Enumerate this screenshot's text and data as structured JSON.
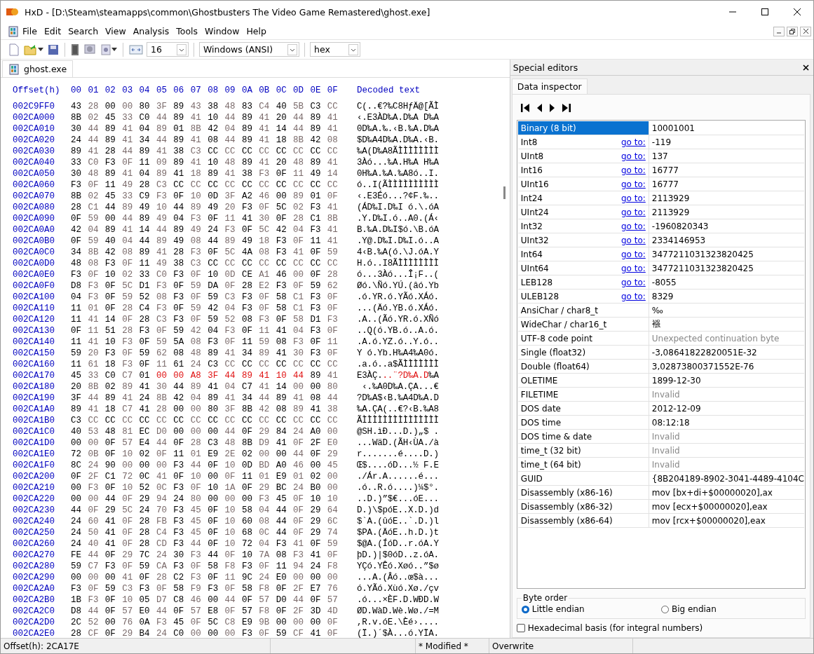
{
  "window": {
    "title": "HxD - [D:\\Steam\\steamapps\\common\\Ghostbusters The Video Game Remastered\\ghost.exe]"
  },
  "menu": [
    "File",
    "Edit",
    "Search",
    "View",
    "Analysis",
    "Tools",
    "Window",
    "Help"
  ],
  "toolbar": {
    "bytes_per_row": "16",
    "charset": "Windows (ANSI)",
    "offset_base": "hex"
  },
  "tabs": [
    {
      "label": "ghost.exe",
      "selected": true
    }
  ],
  "hex": {
    "offset_header": "Offset(h)",
    "columns": [
      "00",
      "01",
      "02",
      "03",
      "04",
      "05",
      "06",
      "07",
      "08",
      "09",
      "0A",
      "0B",
      "0C",
      "0D",
      "0E",
      "0F"
    ],
    "text_header": "Decoded text",
    "rows": [
      {
        "offset": "002C9FF0",
        "segments": [
          {
            "bytes": "43 28 00 00 80 3F 89 43 38 48 83 C4 40 5B C3 CC",
            "text": "C(..€?‰C8HƒÄ@[ÃÌ",
            "selected": false
          }
        ]
      },
      {
        "offset": "002CA000",
        "segments": [
          {
            "bytes": "8B 02 45 33 C0 44 89 41 10 44 89 41 20 44 89 41",
            "text": "‹.E3ÀD‰A.D‰A D‰A",
            "selected": false
          }
        ]
      },
      {
        "offset": "002CA010",
        "segments": [
          {
            "bytes": "30 44 89 41 04 89 01 8B 42 04 89 41 14 44 89 41",
            "text": "0D‰A.‰.‹B.‰A.D‰A",
            "selected": false
          }
        ]
      },
      {
        "offset": "002CA020",
        "segments": [
          {
            "bytes": "24 44 89 41 34 44 89 41 08 44 89 41 18 8B 42 08",
            "text": "$D‰A4D‰A.D‰A.‹B.",
            "selected": false
          }
        ]
      },
      {
        "offset": "002CA030",
        "segments": [
          {
            "bytes": "89 41 28 44 89 41 38 C3 CC CC CC CC CC CC CC CC",
            "text": "‰A(D‰A8ÃÌÌÌÌÌÌÌÌ",
            "selected": false
          }
        ]
      },
      {
        "offset": "002CA040",
        "segments": [
          {
            "bytes": "33 C0 F3 0F 11 09 89 41 10 48 89 41 20 48 89 41",
            "text": "3Àó...‰A.H‰A H‰A",
            "selected": false
          }
        ]
      },
      {
        "offset": "002CA050",
        "segments": [
          {
            "bytes": "30 48 89 41 04 89 41 18 89 41 38 F3 0F 11 49 14",
            "text": "0H‰A.‰A.‰A8ó..I.",
            "selected": false
          }
        ]
      },
      {
        "offset": "002CA060",
        "segments": [
          {
            "bytes": "F3 0F 11 49 28 C3 CC CC CC CC CC CC CC CC CC CC",
            "text": "ó..I(ÃÌÌÌÌÌÌÌÌÌÌ",
            "selected": false
          }
        ]
      },
      {
        "offset": "002CA070",
        "segments": [
          {
            "bytes": "8B 02 45 33 C9 F3 0F 10 0D 3F A2 46 00 89 01 0F",
            "text": "‹.E3Éó...?¢F.‰..",
            "selected": false
          }
        ]
      },
      {
        "offset": "002CA080",
        "segments": [
          {
            "bytes": "28 C1 44 89 49 10 44 89 49 20 F3 0F 5C 02 F3 41",
            "text": "(ÁD‰I.D‰I ó.\\.óA",
            "selected": false
          }
        ]
      },
      {
        "offset": "002CA090",
        "segments": [
          {
            "bytes": "0F 59 00 44 89 49 04 F3 0F 11 41 30 0F 28 C1 8B",
            "text": ".Y.D‰I.ó..A0.(Á‹",
            "selected": false
          }
        ]
      },
      {
        "offset": "002CA0A0",
        "segments": [
          {
            "bytes": "42 04 89 41 14 44 89 49 24 F3 0F 5C 42 04 F3 41",
            "text": "B.‰A.D‰I$ó.\\B.óA",
            "selected": false
          }
        ]
      },
      {
        "offset": "002CA0B0",
        "segments": [
          {
            "bytes": "0F 59 40 04 44 89 49 08 44 89 49 18 F3 0F 11 41",
            "text": ".Y@.D‰I.D‰I.ó..A",
            "selected": false
          }
        ]
      },
      {
        "offset": "002CA0C0",
        "segments": [
          {
            "bytes": "34 8B 42 08 89 41 28 F3 0F 5C 4A 08 F3 41 0F 59",
            "text": "4‹B.‰A(ó.\\J.óA.Y",
            "selected": false
          }
        ]
      },
      {
        "offset": "002CA0D0",
        "segments": [
          {
            "bytes": "48 08 F3 0F 11 49 38 C3 CC CC CC CC CC CC CC CC",
            "text": "H.ó..I8ÃÌÌÌÌÌÌÌÌ",
            "selected": false
          }
        ]
      },
      {
        "offset": "002CA0E0",
        "segments": [
          {
            "bytes": "F3 0F 10 02 33 C0 F3 0F 10 0D CE A1 46 00 0F 28",
            "text": "ó...3Àó...Î¡F..(",
            "selected": false
          }
        ]
      },
      {
        "offset": "002CA0F0",
        "segments": [
          {
            "bytes": "D8 F3 0F 5C D1 F3 0F 59 DA 0F 28 E2 F3 0F 59 62",
            "text": "Øó.\\Ñó.YÚ.(âó.Yb",
            "selected": false
          }
        ]
      },
      {
        "offset": "002CA100",
        "segments": [
          {
            "bytes": "04 F3 0F 59 52 08 F3 0F 59 C3 F3 0F 58 C1 F3 0F",
            "text": ".ó.YR.ó.YÃó.XÁó.",
            "selected": false
          }
        ]
      },
      {
        "offset": "002CA110",
        "segments": [
          {
            "bytes": "11 01 0F 28 C4 F3 0F 59 42 04 F3 0F 58 C1 F3 0F",
            "text": "...(Äó.YB.ó.XÁó.",
            "selected": false
          }
        ]
      },
      {
        "offset": "002CA120",
        "segments": [
          {
            "bytes": "11 41 14 0F 28 C3 F3 0F 59 52 08 F3 0F 58 D1 F3",
            "text": ".A..(Ãó.YR.ó.XÑó",
            "selected": false
          }
        ]
      },
      {
        "offset": "002CA130",
        "segments": [
          {
            "bytes": "0F 11 51 28 F3 0F 59 42 04 F3 0F 11 41 04 F3 0F",
            "text": "..Q(ó.YB.ó..A.ó.",
            "selected": false
          }
        ]
      },
      {
        "offset": "002CA140",
        "segments": [
          {
            "bytes": "11 41 10 F3 0F 59 5A 08 F3 0F 11 59 08 F3 0F 11",
            "text": ".A.ó.YZ.ó..Y.ó..",
            "selected": false
          }
        ]
      },
      {
        "offset": "002CA150",
        "segments": [
          {
            "bytes": "59 20 F3 0F 59 62 08 48 89 41 34 89 41 30 F3 0F",
            "text": "Y ó.Yb.H‰A4‰A0ó.",
            "selected": false
          }
        ]
      },
      {
        "offset": "002CA160",
        "segments": [
          {
            "bytes": "11 61 18 F3 0F 11 61 24 C3 CC CC CC CC CC CC CC",
            "text": ".a.ó..a$ÃÌÌÌÌÌÌÌ",
            "selected": false
          }
        ]
      },
      {
        "offset": "002CA170",
        "segments": [
          {
            "bytes": "45 33 C0 C7 01",
            "text": "E3ÀÇ.",
            "selected": false
          },
          {
            "bytes": "00 00 A8 3F 44 89 41 10 44",
            "text": "..¨?D‰A.D",
            "selected": true
          },
          {
            "bytes": "89 41",
            "text": "‰A",
            "selected": false
          }
        ]
      },
      {
        "offset": "002CA180",
        "segments": [
          {
            "bytes": "20 8B 02 89 41 30 44 89 41 04 C7 41 14 00 00 80",
            "text": " ‹.‰A0D‰A.ÇA...€",
            "selected": false
          }
        ]
      },
      {
        "offset": "002CA190",
        "segments": [
          {
            "bytes": "3F 44 89 41 24 8B 42 04 89 41 34 44 89 41 08 44",
            "text": "?D‰A$‹B.‰A4D‰A.D",
            "selected": false
          }
        ]
      },
      {
        "offset": "002CA1A0",
        "segments": [
          {
            "bytes": "89 41 18 C7 41 28 00 00 80 3F 8B 42 08 89 41 38",
            "text": "‰A.ÇA(..€?‹B.‰A8",
            "selected": false
          }
        ]
      },
      {
        "offset": "002CA1B0",
        "segments": [
          {
            "bytes": "C3 CC CC CC CC CC CC CC CC CC CC CC CC CC CC CC",
            "text": "ÃÌÌÌÌÌÌÌÌÌÌÌÌÌÌÌ",
            "selected": false
          }
        ]
      },
      {
        "offset": "002CA1C0",
        "segments": [
          {
            "bytes": "40 53 48 81 EC D0 00 00 00 44 0F 29 84 24 A0 00",
            "text": "@SH.ìÐ...D.)„$ .",
            "selected": false
          }
        ]
      },
      {
        "offset": "002CA1D0",
        "segments": [
          {
            "bytes": "00 00 0F 57 E4 44 0F 28 C3 48 8B D9 41 0F 2F E0",
            "text": "...WäD.(ÃH‹ÙA./à",
            "selected": false
          }
        ]
      },
      {
        "offset": "002CA1E0",
        "segments": [
          {
            "bytes": "72 0B 0F 10 02 0F 11 01 E9 2E 02 00 00 44 0F 29",
            "text": "r.......é....D.)",
            "selected": false
          }
        ]
      },
      {
        "offset": "002CA1F0",
        "segments": [
          {
            "bytes": "8C 24 90 00 00 00 F3 44 0F 10 0D BD A0 46 00 45",
            "text": "Œ$....óD...½ F.E",
            "selected": false
          }
        ]
      },
      {
        "offset": "002CA200",
        "segments": [
          {
            "bytes": "0F 2F C1 72 0C 41 0F 10 00 0F 11 01 E9 01 02 00",
            "text": "./Ár.A......é...",
            "selected": false
          }
        ]
      },
      {
        "offset": "002CA210",
        "segments": [
          {
            "bytes": "00 F3 0F 10 52 0C F3 0F 10 1A 0F 29 BC 24 B0 00",
            "text": ".ó..R.ó....)¼$°.",
            "selected": false
          }
        ]
      },
      {
        "offset": "002CA220",
        "segments": [
          {
            "bytes": "00 00 44 0F 29 94 24 80 00 00 00 F3 45 0F 10 10",
            "text": "..D.)”$€...óE...",
            "selected": false
          }
        ]
      },
      {
        "offset": "002CA230",
        "segments": [
          {
            "bytes": "44 0F 29 5C 24 70 F3 45 0F 10 58 04 44 0F 29 64",
            "text": "D.)\\$póE..X.D.)d",
            "selected": false
          }
        ]
      },
      {
        "offset": "002CA240",
        "segments": [
          {
            "bytes": "24 60 41 0F 28 FB F3 45 0F 10 60 08 44 0F 29 6C",
            "text": "$`A.(ûóE..`.D.)l",
            "selected": false
          }
        ]
      },
      {
        "offset": "002CA250",
        "segments": [
          {
            "bytes": "24 50 41 0F 28 C4 F3 45 0F 10 68 0C 44 0F 29 74",
            "text": "$PA.(ÄóE..h.D.)t",
            "selected": false
          }
        ]
      },
      {
        "offset": "002CA260",
        "segments": [
          {
            "bytes": "24 40 41 0F 28 CD F3 44 0F 10 72 04 F3 41 0F 59",
            "text": "$@A.(ÍóD..r.óA.Y",
            "selected": false
          }
        ]
      },
      {
        "offset": "002CA270",
        "segments": [
          {
            "bytes": "FE 44 0F 29 7C 24 30 F3 44 0F 10 7A 08 F3 41 0F",
            "text": "þD.)|$0óD..z.óA.",
            "selected": false
          }
        ]
      },
      {
        "offset": "002CA280",
        "segments": [
          {
            "bytes": "59 C7 F3 0F 59 CA F3 0F 58 F8 F3 0F 11 94 24 F8",
            "text": "YÇó.YÊó.Xøó..”$ø",
            "selected": false
          }
        ]
      },
      {
        "offset": "002CA290",
        "segments": [
          {
            "bytes": "00 00 00 41 0F 28 C2 F3 0F 11 9C 24 E0 00 00 00",
            "text": "...A.(Âó..œ$à...",
            "selected": false
          }
        ]
      },
      {
        "offset": "002CA2A0",
        "segments": [
          {
            "bytes": "F3 0F 59 C3 F3 0F 58 F9 F3 0F 58 F8 0F 2F E7 76",
            "text": "ó.YÃó.Xùó.Xø./çv",
            "selected": false
          }
        ]
      },
      {
        "offset": "002CA2B0",
        "segments": [
          {
            "bytes": "1B F3 0F 10 05 D7 C8 46 00 44 0F 57 D0 44 0F 57",
            "text": ".ó...×ÈF.D.WÐD.W",
            "selected": false
          }
        ]
      },
      {
        "offset": "002CA2C0",
        "segments": [
          {
            "bytes": "D8 44 0F 57 E0 44 0F 57 E8 0F 57 F8 0F 2F 3D 4D",
            "text": "ØD.WàD.Wè.Wø./=M",
            "selected": false
          }
        ]
      },
      {
        "offset": "002CA2D0",
        "segments": [
          {
            "bytes": "2C 52 00 76 0A F3 45 0F 5C C8 E9 9B 00 00 00 0F",
            "text": ",R.v.óE.\\Èé›....",
            "selected": false
          }
        ]
      },
      {
        "offset": "002CA2E0",
        "segments": [
          {
            "bytes": "28 CF 0F 29 B4 24 C0 00 00 00 F3 0F 59 CF 41 0F",
            "text": "(Ï.)´$À...ó.YÏA.",
            "selected": false
          }
        ]
      }
    ]
  },
  "inspector": {
    "title": "Special editors",
    "tab": "Data inspector",
    "rows": [
      {
        "name": "Binary (8 bit)",
        "value": "10001001",
        "muted": false,
        "selected": true
      },
      {
        "name": "Int8",
        "goto": "go to:",
        "value": "-119",
        "muted": false,
        "selected": false
      },
      {
        "name": "UInt8",
        "goto": "go to:",
        "value": "137",
        "muted": false,
        "selected": false
      },
      {
        "name": "Int16",
        "goto": "go to:",
        "value": "16777",
        "muted": false,
        "selected": false
      },
      {
        "name": "UInt16",
        "goto": "go to:",
        "value": "16777",
        "muted": false,
        "selected": false
      },
      {
        "name": "Int24",
        "goto": "go to:",
        "value": "2113929",
        "muted": false,
        "selected": false
      },
      {
        "name": "UInt24",
        "goto": "go to:",
        "value": "2113929",
        "muted": false,
        "selected": false
      },
      {
        "name": "Int32",
        "goto": "go to:",
        "value": "-1960820343",
        "muted": false,
        "selected": false
      },
      {
        "name": "UInt32",
        "goto": "go to:",
        "value": "2334146953",
        "muted": false,
        "selected": false
      },
      {
        "name": "Int64",
        "goto": "go to:",
        "value": "3477211031323820425",
        "muted": false,
        "selected": false
      },
      {
        "name": "UInt64",
        "goto": "go to:",
        "value": "3477211031323820425",
        "muted": false,
        "selected": false
      },
      {
        "name": "LEB128",
        "goto": "go to:",
        "value": "-8055",
        "muted": false,
        "selected": false
      },
      {
        "name": "ULEB128",
        "goto": "go to:",
        "value": "8329",
        "muted": false,
        "selected": false
      },
      {
        "name": "AnsiChar / char8_t",
        "value": "‰",
        "muted": false,
        "selected": false
      },
      {
        "name": "WideChar / char16_t",
        "value": "襁",
        "muted": false,
        "selected": false
      },
      {
        "name": "UTF-8 code point",
        "value": "Unexpected continuation byte",
        "muted": true,
        "selected": false
      },
      {
        "name": "Single (float32)",
        "value": "-3,08641822820051E-32",
        "muted": false,
        "selected": false
      },
      {
        "name": "Double (float64)",
        "value": "3,02873800371552E-76",
        "muted": false,
        "selected": false
      },
      {
        "name": "OLETIME",
        "value": "1899-12-30",
        "muted": false,
        "selected": false
      },
      {
        "name": "FILETIME",
        "value": "Invalid",
        "muted": true,
        "selected": false
      },
      {
        "name": "DOS date",
        "value": "2012-12-09",
        "muted": false,
        "selected": false
      },
      {
        "name": "DOS time",
        "value": "08:12:18",
        "muted": false,
        "selected": false
      },
      {
        "name": "DOS time & date",
        "value": "Invalid",
        "muted": true,
        "selected": false
      },
      {
        "name": "time_t (32 bit)",
        "value": "Invalid",
        "muted": true,
        "selected": false
      },
      {
        "name": "time_t (64 bit)",
        "value": "Invalid",
        "muted": true,
        "selected": false
      },
      {
        "name": "GUID",
        "value": "{8B204189-8902-3041-4489-4104C",
        "muted": false,
        "selected": false
      },
      {
        "name": "Disassembly (x86-16)",
        "value": "mov [bx+di+$00000020],ax",
        "muted": false,
        "selected": false
      },
      {
        "name": "Disassembly (x86-32)",
        "value": "mov [ecx+$00000020],eax",
        "muted": false,
        "selected": false
      },
      {
        "name": "Disassembly (x86-64)",
        "value": "mov [rcx+$00000020],eax",
        "muted": false,
        "selected": false
      }
    ],
    "byte_order": {
      "label": "Byte order",
      "options": [
        {
          "label": "Little endian",
          "selected": true
        },
        {
          "label": "Big endian",
          "selected": false
        }
      ]
    },
    "hex_basis": {
      "label": "Hexadecimal basis (for integral numbers)",
      "checked": false
    }
  },
  "status_bar": {
    "offset": "Offset(h): 2CA17E",
    "modified": "* Modified *",
    "mode": "Overwrite"
  }
}
